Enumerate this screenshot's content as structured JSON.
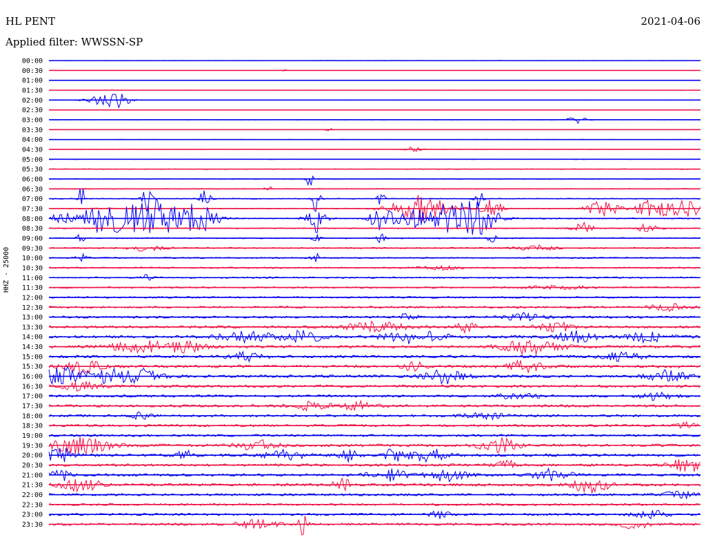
{
  "header": {
    "station": "HL PENT",
    "date": "2021-04-06",
    "filter_label": "Applied filter: WWSSN-SP"
  },
  "colors": {
    "blue": "#0000ee",
    "red": "#ee1144"
  },
  "chart_data": {
    "type": "line",
    "ylabel": "HHZ - 25000",
    "traces": [
      {
        "time": "00:00",
        "color": "blue",
        "noise": 0.3,
        "events": []
      },
      {
        "time": "00:30",
        "color": "red",
        "noise": 0.3,
        "events": [
          {
            "t": 0.36,
            "a": 2,
            "w": 0.003
          }
        ]
      },
      {
        "time": "01:00",
        "color": "blue",
        "noise": 0.3,
        "events": []
      },
      {
        "time": "01:30",
        "color": "red",
        "noise": 0.3,
        "events": []
      },
      {
        "time": "02:00",
        "color": "blue",
        "noise": 0.4,
        "events": [
          {
            "t": 0.09,
            "a": 9,
            "w": 0.02
          },
          {
            "t": 0.11,
            "a": 5,
            "w": 0.01
          }
        ]
      },
      {
        "time": "02:30",
        "color": "red",
        "noise": 0.3,
        "events": []
      },
      {
        "time": "03:00",
        "color": "blue",
        "noise": 0.4,
        "events": [
          {
            "t": 0.81,
            "a": 5,
            "w": 0.01
          }
        ]
      },
      {
        "time": "03:30",
        "color": "red",
        "noise": 0.4,
        "events": [
          {
            "t": 0.43,
            "a": 2,
            "w": 0.004
          }
        ]
      },
      {
        "time": "04:00",
        "color": "blue",
        "noise": 0.5,
        "events": []
      },
      {
        "time": "04:30",
        "color": "red",
        "noise": 0.5,
        "events": [
          {
            "t": 0.56,
            "a": 4,
            "w": 0.008
          }
        ]
      },
      {
        "time": "05:00",
        "color": "blue",
        "noise": 0.7,
        "events": []
      },
      {
        "time": "05:30",
        "color": "red",
        "noise": 0.9,
        "events": []
      },
      {
        "time": "06:00",
        "color": "blue",
        "noise": 0.9,
        "events": [
          {
            "t": 0.4,
            "a": 20,
            "w": 0.003
          }
        ]
      },
      {
        "time": "06:30",
        "color": "red",
        "noise": 1.0,
        "events": [
          {
            "t": 0.34,
            "a": 3,
            "w": 0.005
          }
        ]
      },
      {
        "time": "07:00",
        "color": "blue",
        "noise": 1.1,
        "events": [
          {
            "t": 0.05,
            "a": 20,
            "w": 0.003
          },
          {
            "t": 0.15,
            "a": 18,
            "w": 0.005
          },
          {
            "t": 0.24,
            "a": 18,
            "w": 0.005
          },
          {
            "t": 0.41,
            "a": 22,
            "w": 0.004
          },
          {
            "t": 0.51,
            "a": 16,
            "w": 0.003
          },
          {
            "t": 0.66,
            "a": 15,
            "w": 0.004
          }
        ]
      },
      {
        "time": "07:30",
        "color": "red",
        "noise": 1.2,
        "events": [
          {
            "t": 0.57,
            "a": 20,
            "w": 0.03
          },
          {
            "t": 0.68,
            "a": 16,
            "w": 0.01
          },
          {
            "t": 0.85,
            "a": 14,
            "w": 0.015
          },
          {
            "t": 0.93,
            "a": 14,
            "w": 0.02
          },
          {
            "t": 0.98,
            "a": 12,
            "w": 0.015
          }
        ]
      },
      {
        "time": "08:00",
        "color": "blue",
        "noise": 1.5,
        "events": [
          {
            "t": 0.02,
            "a": 10,
            "w": 0.01
          },
          {
            "t": 0.07,
            "a": 16,
            "w": 0.015
          },
          {
            "t": 0.12,
            "a": 20,
            "w": 0.03
          },
          {
            "t": 0.17,
            "a": 22,
            "w": 0.03
          },
          {
            "t": 0.23,
            "a": 18,
            "w": 0.02
          },
          {
            "t": 0.41,
            "a": 24,
            "w": 0.01
          },
          {
            "t": 0.51,
            "a": 22,
            "w": 0.01
          },
          {
            "t": 0.6,
            "a": 22,
            "w": 0.04
          },
          {
            "t": 0.66,
            "a": 18,
            "w": 0.02
          }
        ]
      },
      {
        "time": "08:30",
        "color": "red",
        "noise": 1.3,
        "events": [
          {
            "t": 0.82,
            "a": 8,
            "w": 0.01
          },
          {
            "t": 0.92,
            "a": 8,
            "w": 0.01
          }
        ]
      },
      {
        "time": "09:00",
        "color": "blue",
        "noise": 1.4,
        "events": [
          {
            "t": 0.05,
            "a": 10,
            "w": 0.004
          },
          {
            "t": 0.41,
            "a": 10,
            "w": 0.004
          },
          {
            "t": 0.51,
            "a": 8,
            "w": 0.004
          },
          {
            "t": 0.68,
            "a": 8,
            "w": 0.004
          }
        ]
      },
      {
        "time": "09:30",
        "color": "red",
        "noise": 1.6,
        "events": [
          {
            "t": 0.15,
            "a": 4,
            "w": 0.02
          },
          {
            "t": 0.75,
            "a": 4,
            "w": 0.02
          }
        ]
      },
      {
        "time": "10:00",
        "color": "blue",
        "noise": 1.6,
        "events": [
          {
            "t": 0.05,
            "a": 6,
            "w": 0.005
          },
          {
            "t": 0.41,
            "a": 6,
            "w": 0.005
          }
        ]
      },
      {
        "time": "10:30",
        "color": "red",
        "noise": 1.7,
        "events": [
          {
            "t": 0.6,
            "a": 3,
            "w": 0.02
          }
        ]
      },
      {
        "time": "11:00",
        "color": "blue",
        "noise": 1.8,
        "events": [
          {
            "t": 0.15,
            "a": 6,
            "w": 0.005
          }
        ]
      },
      {
        "time": "11:30",
        "color": "red",
        "noise": 1.9,
        "events": [
          {
            "t": 0.78,
            "a": 3,
            "w": 0.03
          }
        ]
      },
      {
        "time": "12:00",
        "color": "blue",
        "noise": 2.0,
        "events": []
      },
      {
        "time": "12:30",
        "color": "red",
        "noise": 2.3,
        "events": [
          {
            "t": 0.95,
            "a": 5,
            "w": 0.02
          }
        ]
      },
      {
        "time": "13:00",
        "color": "blue",
        "noise": 2.6,
        "events": [
          {
            "t": 0.55,
            "a": 5,
            "w": 0.01
          },
          {
            "t": 0.73,
            "a": 6,
            "w": 0.02
          }
        ]
      },
      {
        "time": "13:30",
        "color": "red",
        "noise": 3.0,
        "events": [
          {
            "t": 0.5,
            "a": 7,
            "w": 0.03
          },
          {
            "t": 0.64,
            "a": 8,
            "w": 0.01
          },
          {
            "t": 0.78,
            "a": 6,
            "w": 0.02
          }
        ]
      },
      {
        "time": "14:00",
        "color": "blue",
        "noise": 3.2,
        "events": [
          {
            "t": 0.31,
            "a": 8,
            "w": 0.03
          },
          {
            "t": 0.39,
            "a": 8,
            "w": 0.02
          },
          {
            "t": 0.56,
            "a": 10,
            "w": 0.03
          },
          {
            "t": 0.81,
            "a": 8,
            "w": 0.02
          },
          {
            "t": 0.92,
            "a": 7,
            "w": 0.02
          }
        ]
      },
      {
        "time": "14:30",
        "color": "red",
        "noise": 3.2,
        "events": [
          {
            "t": 0.14,
            "a": 8,
            "w": 0.03
          },
          {
            "t": 0.21,
            "a": 7,
            "w": 0.02
          },
          {
            "t": 0.74,
            "a": 10,
            "w": 0.03
          }
        ]
      },
      {
        "time": "15:00",
        "color": "blue",
        "noise": 3.0,
        "events": [
          {
            "t": 0.3,
            "a": 6,
            "w": 0.02
          },
          {
            "t": 0.88,
            "a": 6,
            "w": 0.02
          }
        ]
      },
      {
        "time": "15:30",
        "color": "red",
        "noise": 3.2,
        "events": [
          {
            "t": 0.05,
            "a": 10,
            "w": 0.02
          },
          {
            "t": 0.56,
            "a": 7,
            "w": 0.01
          },
          {
            "t": 0.73,
            "a": 8,
            "w": 0.02
          }
        ]
      },
      {
        "time": "16:00",
        "color": "blue",
        "noise": 3.3,
        "events": [
          {
            "t": 0.02,
            "a": 14,
            "w": 0.02
          },
          {
            "t": 0.09,
            "a": 10,
            "w": 0.02
          },
          {
            "t": 0.14,
            "a": 10,
            "w": 0.02
          },
          {
            "t": 0.61,
            "a": 10,
            "w": 0.02
          },
          {
            "t": 0.95,
            "a": 9,
            "w": 0.02
          }
        ]
      },
      {
        "time": "16:30",
        "color": "red",
        "noise": 3.0,
        "events": [
          {
            "t": 0.05,
            "a": 6,
            "w": 0.02
          }
        ]
      },
      {
        "time": "17:00",
        "color": "blue",
        "noise": 2.8,
        "events": [
          {
            "t": 0.72,
            "a": 5,
            "w": 0.02
          },
          {
            "t": 0.93,
            "a": 5,
            "w": 0.02
          }
        ]
      },
      {
        "time": "17:30",
        "color": "red",
        "noise": 3.0,
        "events": [
          {
            "t": 0.4,
            "a": 6,
            "w": 0.02
          },
          {
            "t": 0.47,
            "a": 6,
            "w": 0.02
          }
        ]
      },
      {
        "time": "18:00",
        "color": "blue",
        "noise": 2.8,
        "events": [
          {
            "t": 0.14,
            "a": 6,
            "w": 0.01
          },
          {
            "t": 0.67,
            "a": 5,
            "w": 0.02
          }
        ]
      },
      {
        "time": "18:30",
        "color": "red",
        "noise": 2.8,
        "events": [
          {
            "t": 0.98,
            "a": 4,
            "w": 0.01
          }
        ]
      },
      {
        "time": "19:00",
        "color": "blue",
        "noise": 2.6,
        "events": []
      },
      {
        "time": "19:30",
        "color": "red",
        "noise": 3.2,
        "events": [
          {
            "t": 0.05,
            "a": 12,
            "w": 0.03
          },
          {
            "t": 0.32,
            "a": 7,
            "w": 0.02
          },
          {
            "t": 0.69,
            "a": 10,
            "w": 0.02
          }
        ]
      },
      {
        "time": "20:00",
        "color": "blue",
        "noise": 3.2,
        "events": [
          {
            "t": 0.02,
            "a": 10,
            "w": 0.02
          },
          {
            "t": 0.21,
            "a": 6,
            "w": 0.01
          },
          {
            "t": 0.36,
            "a": 8,
            "w": 0.02
          },
          {
            "t": 0.46,
            "a": 9,
            "w": 0.01
          },
          {
            "t": 0.53,
            "a": 10,
            "w": 0.01
          },
          {
            "t": 0.58,
            "a": 10,
            "w": 0.02
          }
        ]
      },
      {
        "time": "20:30",
        "color": "red",
        "noise": 3.0,
        "events": [
          {
            "t": 0.7,
            "a": 8,
            "w": 0.01
          },
          {
            "t": 0.98,
            "a": 10,
            "w": 0.02
          }
        ]
      },
      {
        "time": "21:00",
        "color": "blue",
        "noise": 3.2,
        "events": [
          {
            "t": 0.02,
            "a": 9,
            "w": 0.01
          },
          {
            "t": 0.52,
            "a": 8,
            "w": 0.02
          },
          {
            "t": 0.61,
            "a": 8,
            "w": 0.02
          },
          {
            "t": 0.77,
            "a": 8,
            "w": 0.02
          }
        ]
      },
      {
        "time": "21:30",
        "color": "red",
        "noise": 3.2,
        "events": [
          {
            "t": 0.05,
            "a": 10,
            "w": 0.02
          },
          {
            "t": 0.45,
            "a": 8,
            "w": 0.01
          },
          {
            "t": 0.83,
            "a": 12,
            "w": 0.02
          }
        ]
      },
      {
        "time": "22:00",
        "color": "blue",
        "noise": 2.6,
        "events": [
          {
            "t": 0.97,
            "a": 5,
            "w": 0.02
          }
        ]
      },
      {
        "time": "22:30",
        "color": "red",
        "noise": 2.4,
        "events": []
      },
      {
        "time": "23:00",
        "color": "blue",
        "noise": 2.6,
        "events": [
          {
            "t": 0.6,
            "a": 5,
            "w": 0.01
          },
          {
            "t": 0.92,
            "a": 6,
            "w": 0.02
          }
        ]
      },
      {
        "time": "23:30",
        "color": "red",
        "noise": 2.8,
        "events": [
          {
            "t": 0.32,
            "a": 6,
            "w": 0.02
          },
          {
            "t": 0.39,
            "a": 16,
            "w": 0.005
          },
          {
            "t": 0.9,
            "a": 6,
            "w": 0.02
          }
        ]
      }
    ]
  }
}
